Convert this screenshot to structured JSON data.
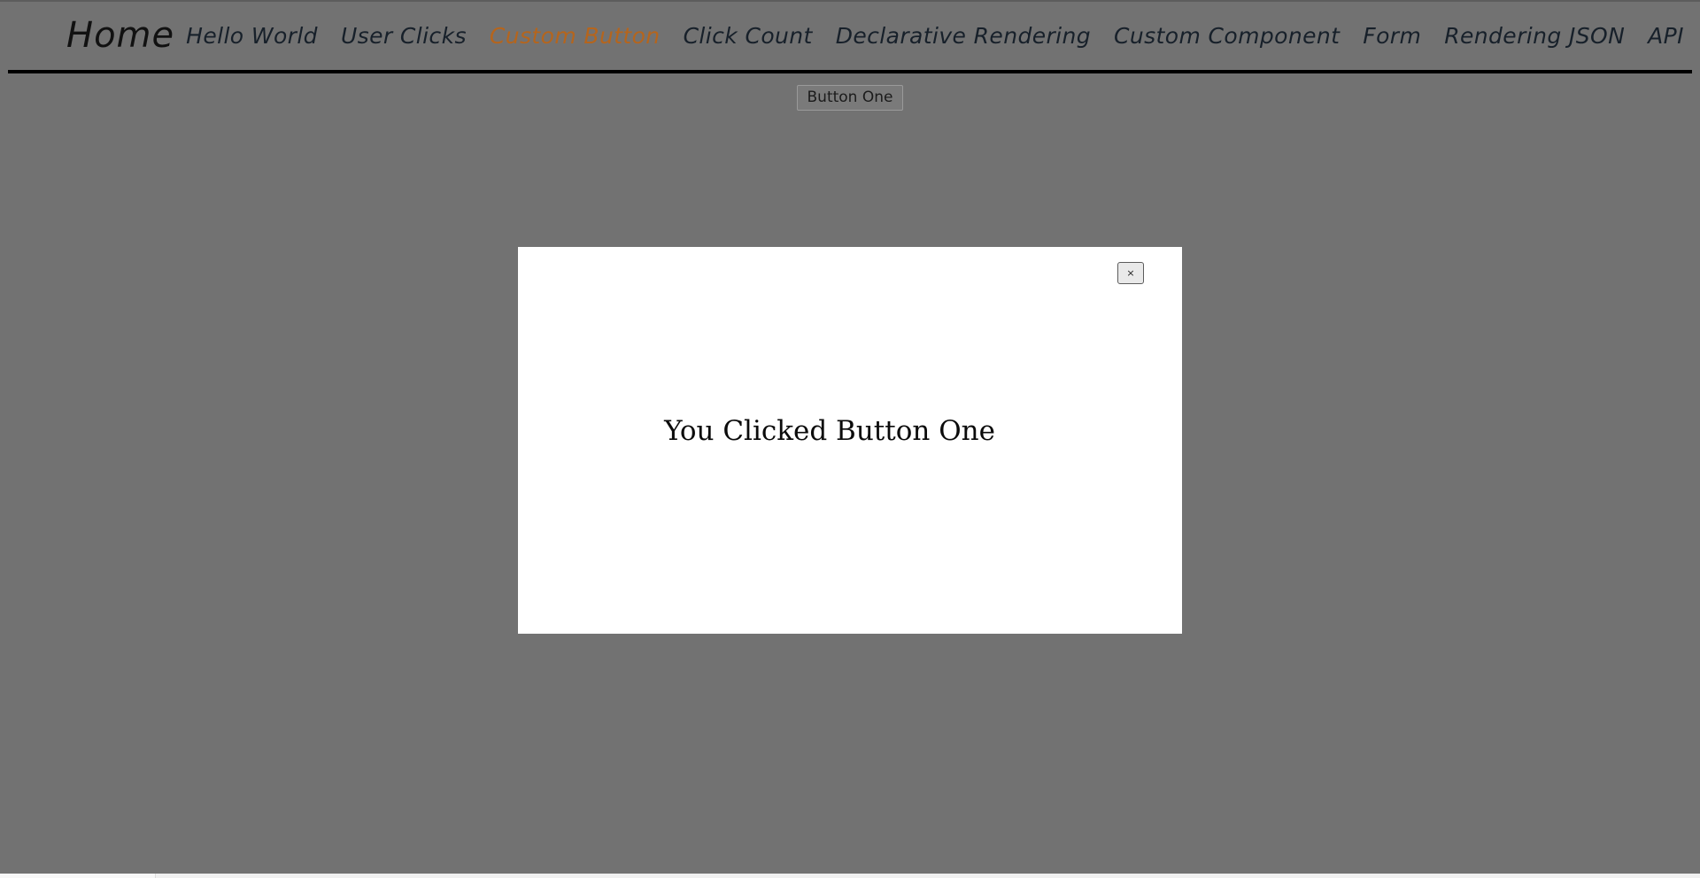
{
  "header": {
    "brand": "Home",
    "nav": [
      {
        "label": "Hello World",
        "active": false
      },
      {
        "label": "User Clicks",
        "active": false
      },
      {
        "label": "Custom Button",
        "active": true
      },
      {
        "label": "Click Count",
        "active": false
      },
      {
        "label": "Declarative Rendering",
        "active": false
      },
      {
        "label": "Custom Component",
        "active": false
      },
      {
        "label": "Form",
        "active": false
      },
      {
        "label": "Rendering JSON",
        "active": false
      },
      {
        "label": "API",
        "active": false
      }
    ]
  },
  "main": {
    "trigger_button_label": "Button One"
  },
  "modal": {
    "close_label": "×",
    "close_icon": "close-icon",
    "message": "You Clicked Button One"
  },
  "colors": {
    "page_background": "#727272",
    "active_nav": "#b5651d",
    "nav_text": "#17202a",
    "rule": "#000000",
    "modal_background": "#ffffff",
    "modal_text": "#0b0b0b"
  }
}
